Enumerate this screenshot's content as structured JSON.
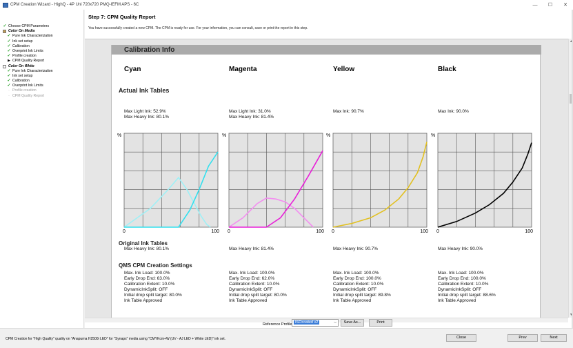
{
  "window": {
    "title": "CPM Creation Wizard - HighQ - 4P Uni 720x720 PMQ-IEFM APS - 6C",
    "minimize": "—",
    "maximize": "☐",
    "close": "✕"
  },
  "sidebar": {
    "items": [
      {
        "label": "Choose CPM Parameters",
        "state": "done",
        "level": 0
      },
      {
        "label": "Color On Media",
        "state": "section",
        "level": 0
      },
      {
        "label": "Pure Ink Characterization",
        "state": "done",
        "level": 1
      },
      {
        "label": "Ink set setup",
        "state": "done",
        "level": 1
      },
      {
        "label": "Calibration",
        "state": "done",
        "level": 1
      },
      {
        "label": "Overprint Ink Limits",
        "state": "done",
        "level": 1
      },
      {
        "label": "Profile creation",
        "state": "done",
        "level": 1
      },
      {
        "label": "CPM Quality Report",
        "state": "current",
        "level": 1
      },
      {
        "label": "Color On White",
        "state": "section",
        "level": 0
      },
      {
        "label": "Pure Ink Characterization",
        "state": "done",
        "level": 1
      },
      {
        "label": "Ink set setup",
        "state": "done",
        "level": 1
      },
      {
        "label": "Calibration",
        "state": "done",
        "level": 1
      },
      {
        "label": "Overprint Ink Limits",
        "state": "done",
        "level": 1
      },
      {
        "label": "Profile creation",
        "state": "pending",
        "level": 1
      },
      {
        "label": "CPM Quality Report",
        "state": "pending",
        "level": 1
      }
    ]
  },
  "main": {
    "step_title": "Step 7: CPM Quality Report",
    "description": "You have successfully created a new CPM. The CPM is ready for use. For your information, you can consult, save or print the report in this step."
  },
  "report": {
    "band_title": "Calibration Info",
    "actual_title": "Actual Ink Tables",
    "original_title": "Original Ink Tables",
    "qms_title": "QMS CPM Creation Settings",
    "axis": {
      "percent": "%",
      "min": "0",
      "max": "100"
    },
    "columns": [
      {
        "name": "Cyan",
        "color": "#33e0ee",
        "light_color": "#9ff0f6",
        "actual": [
          "Max Light Ink: 52.9%",
          "Max Heavy Ink: 80.1%"
        ],
        "original": "Max Heavy Ink: 80.1%",
        "settings": [
          "Max. Ink Load: 100.0%",
          "Early Drop End: 63.0%",
          "Calibration Extent: 10.0%",
          "DynamicInkSplit: OFF",
          "Initial drop split target: 80.0%",
          "Ink Table Approved"
        ]
      },
      {
        "name": "Magenta",
        "color": "#e820d8",
        "light_color": "#f38ef0",
        "actual": [
          "Max Light Ink: 31.0%",
          "Max Heavy Ink: 81.4%"
        ],
        "original": "Max Heavy Ink: 81.4%",
        "settings": [
          "Max. Ink Load: 100.0%",
          "Early Drop End: 62.0%",
          "Calibration Extent: 10.0%",
          "DynamicInkSplit: OFF",
          "Initial drop split target: 80.0%",
          "Ink Table Approved"
        ]
      },
      {
        "name": "Yellow",
        "color": "#e2c020",
        "light_color": "#e2c020",
        "actual": [
          "Max Ink: 90.7%"
        ],
        "original": "Max Heavy Ink: 90.7%",
        "settings": [
          "Max. Ink Load: 100.0%",
          "Early Drop End: 100.0%",
          "Calibration Extent: 10.0%",
          "DynamicInkSplit: OFF",
          "Initial drop split target: 89.8%",
          "Ink Table Approved"
        ]
      },
      {
        "name": "Black",
        "color": "#000000",
        "light_color": "#000000",
        "actual": [
          "Max Ink: 90.0%"
        ],
        "original": "Max Heavy Ink: 90.0%",
        "settings": [
          "Max. Ink Load: 100.0%",
          "Early Drop End: 100.0%",
          "Calibration Extent: 10.0%",
          "DynamicInkSplit: OFF",
          "Initial drop split target: 88.6%",
          "Ink Table Approved"
        ]
      }
    ]
  },
  "chart_data": [
    {
      "type": "line",
      "name": "Cyan",
      "xlim": [
        0,
        100
      ],
      "ylim": [
        0,
        100
      ],
      "grid": true,
      "series": [
        {
          "x": [
            0,
            28,
            47,
            58,
            67,
            75,
            82,
            88,
            92
          ],
          "y": [
            0,
            20,
            40,
            52.9,
            40,
            25,
            12,
            3,
            0
          ]
        },
        {
          "x": [
            0,
            58,
            70,
            80,
            90,
            100
          ],
          "y": [
            0,
            0,
            18,
            40,
            65,
            80.1
          ]
        }
      ]
    },
    {
      "type": "line",
      "name": "Magenta",
      "xlim": [
        0,
        100
      ],
      "ylim": [
        0,
        100
      ],
      "grid": true,
      "series": [
        {
          "x": [
            0,
            15,
            30,
            40,
            50,
            60,
            70,
            80,
            90
          ],
          "y": [
            0,
            10,
            25,
            31,
            30,
            27,
            20,
            10,
            0
          ]
        },
        {
          "x": [
            0,
            40,
            55,
            70,
            85,
            100
          ],
          "y": [
            0,
            0,
            10,
            30,
            55,
            81.4
          ]
        }
      ]
    },
    {
      "type": "line",
      "name": "Yellow",
      "xlim": [
        0,
        100
      ],
      "ylim": [
        0,
        100
      ],
      "grid": true,
      "series": [
        {
          "x": [
            0,
            20,
            40,
            55,
            70,
            80,
            90,
            96,
            100
          ],
          "y": [
            0,
            4,
            10,
            18,
            30,
            42,
            58,
            75,
            90.7
          ]
        }
      ]
    },
    {
      "type": "line",
      "name": "Black",
      "xlim": [
        0,
        100
      ],
      "ylim": [
        0,
        100
      ],
      "grid": true,
      "series": [
        {
          "x": [
            0,
            20,
            40,
            55,
            70,
            80,
            90,
            96,
            100
          ],
          "y": [
            0,
            6,
            15,
            24,
            36,
            48,
            63,
            78,
            90.0
          ]
        }
      ]
    }
  ],
  "bottom": {
    "ref_label": "Reference Profile:",
    "ref_value": "ISOcoated v2",
    "save_as": "Save As...",
    "print": "Print"
  },
  "footer": {
    "status": "CPM Creation for \"High Quality\" quality on \"Anapurna H2500i LED\" for \"Synaps\" media using \"CMYKcm+W (UV - AJ LED + White LED)\" ink set.",
    "close": "Close",
    "prev": "Prev",
    "next": "Next"
  }
}
